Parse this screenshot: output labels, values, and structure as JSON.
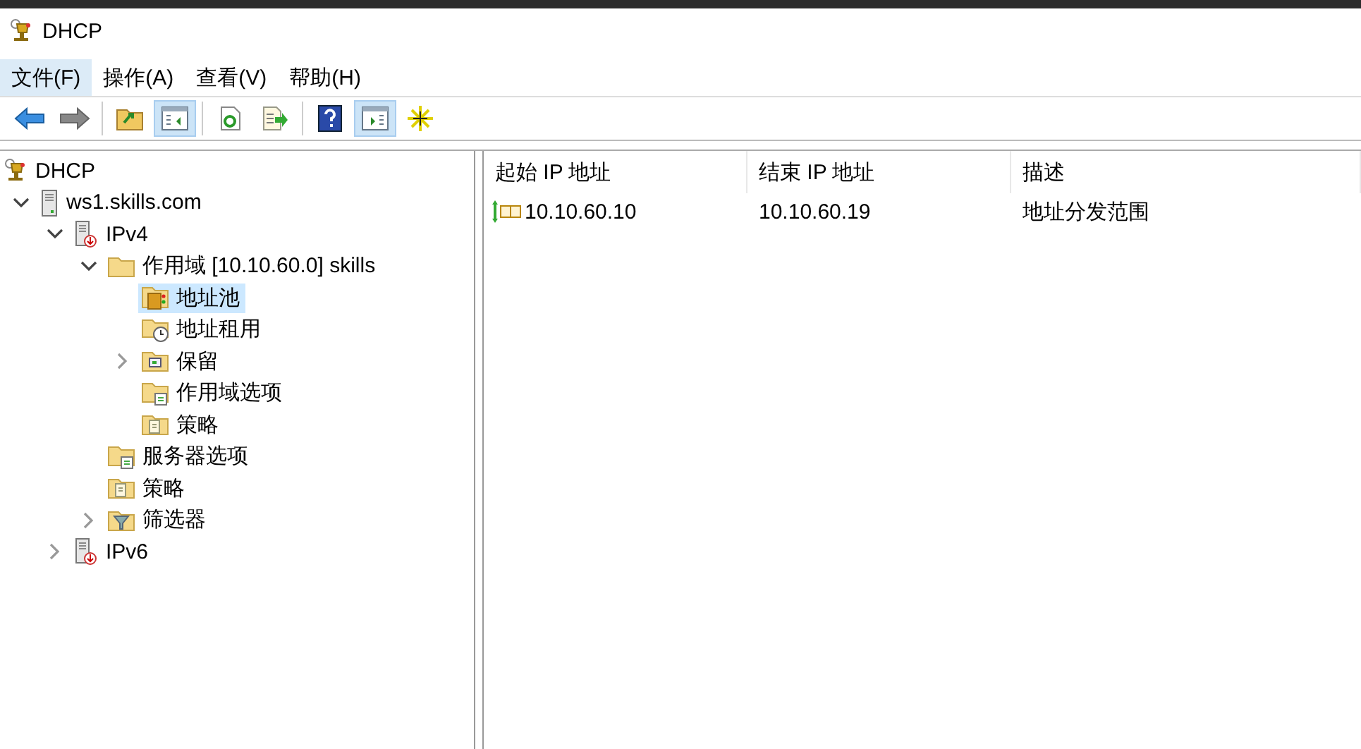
{
  "window": {
    "title": "DHCP"
  },
  "menu": [
    {
      "label": "文件(F)",
      "selected": true
    },
    {
      "label": "操作(A)",
      "selected": false
    },
    {
      "label": "查看(V)",
      "selected": false
    },
    {
      "label": "帮助(H)",
      "selected": false
    }
  ],
  "toolbar": [
    [
      {
        "kind": "back",
        "on": false
      },
      {
        "kind": "forward",
        "on": false
      }
    ],
    [
      {
        "kind": "up",
        "on": false
      },
      {
        "kind": "tree-pane",
        "on": true
      }
    ],
    [
      {
        "kind": "refresh",
        "on": false
      },
      {
        "kind": "export",
        "on": false
      }
    ],
    [
      {
        "kind": "help",
        "on": false
      },
      {
        "kind": "action-pane",
        "on": true
      },
      {
        "kind": "star",
        "on": false
      }
    ]
  ],
  "tree": [
    {
      "label": "DHCP",
      "kind": "dhcp",
      "selected": false,
      "children": [
        {
          "label": "ws1.skills.com",
          "kind": "server",
          "selected": false,
          "expanded": true,
          "children": [
            {
              "label": "IPv4",
              "kind": "ip",
              "selected": false,
              "expanded": true,
              "children": [
                {
                  "label": "作用域 [10.10.60.0] skills",
                  "kind": "folder",
                  "selected": false,
                  "expanded": true,
                  "children": [
                    {
                      "label": "地址池",
                      "kind": "pool",
                      "selected": true
                    },
                    {
                      "label": "地址租用",
                      "kind": "lease",
                      "selected": false
                    },
                    {
                      "label": "保留",
                      "kind": "reserve",
                      "selected": false,
                      "expanded": false
                    },
                    {
                      "label": "作用域选项",
                      "kind": "options",
                      "selected": false
                    },
                    {
                      "label": "策略",
                      "kind": "policy",
                      "selected": false
                    }
                  ]
                },
                {
                  "label": "服务器选项",
                  "kind": "options",
                  "selected": false
                },
                {
                  "label": "策略",
                  "kind": "policy",
                  "selected": false
                },
                {
                  "label": "筛选器",
                  "kind": "filter",
                  "selected": false,
                  "expanded": false
                }
              ]
            },
            {
              "label": "IPv6",
              "kind": "ip",
              "selected": false,
              "expanded": false
            }
          ]
        }
      ]
    }
  ],
  "table": {
    "columns": [
      "起始 IP 地址",
      "结束 IP 地址",
      "描述"
    ],
    "rows": [
      {
        "cells": [
          "10.10.60.10",
          "10.10.60.19",
          "地址分发范围"
        ]
      }
    ]
  }
}
